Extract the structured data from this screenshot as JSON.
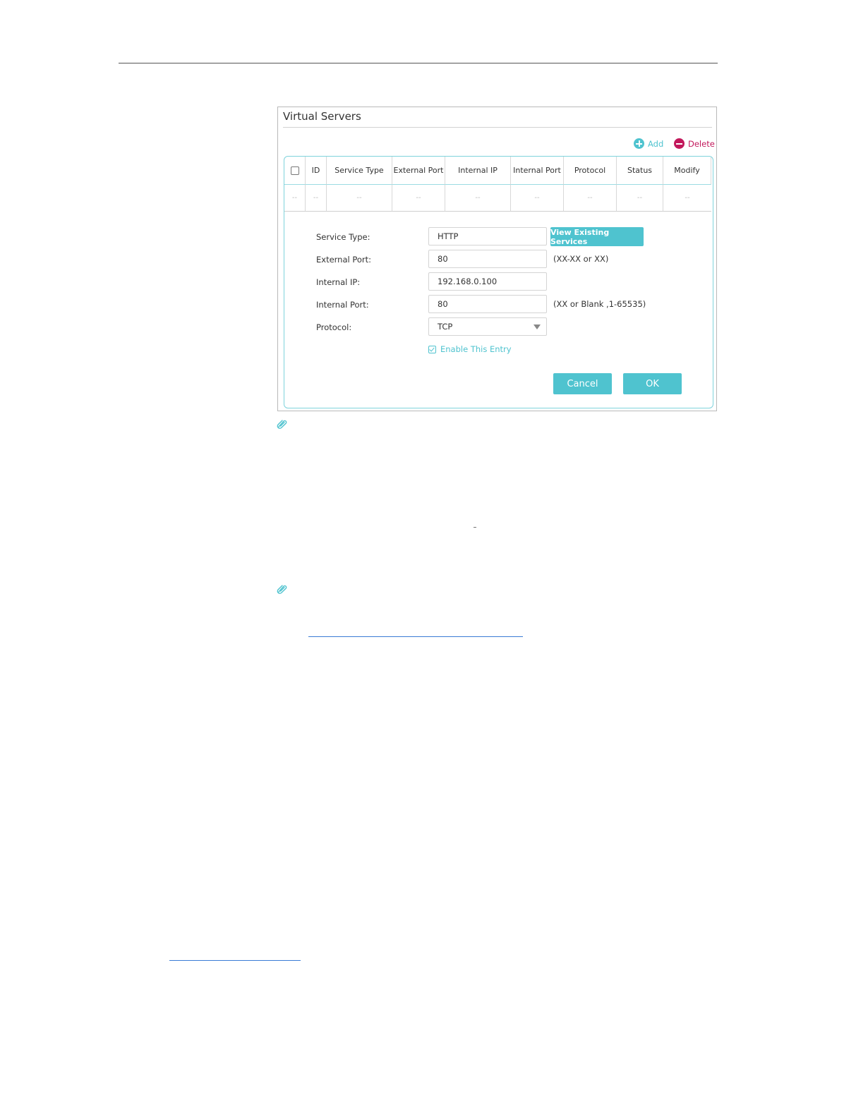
{
  "panel": {
    "title": "Virtual Servers",
    "add_label": "Add",
    "delete_label": "Delete"
  },
  "table": {
    "columns": [
      "ID",
      "Service Type",
      "External Port",
      "Internal IP",
      "Internal Port",
      "Protocol",
      "Status",
      "Modify"
    ],
    "empty_row": [
      "--",
      "--",
      "--",
      "--",
      "--",
      "--",
      "--",
      "--",
      "--"
    ]
  },
  "form": {
    "service_type_label": "Service Type:",
    "service_type_value": "HTTP",
    "view_services_label": "View Existing Services",
    "external_port_label": "External Port:",
    "external_port_value": "80",
    "external_port_hint": "(XX-XX or XX)",
    "internal_ip_label": "Internal IP:",
    "internal_ip_value": "192.168.0.100",
    "internal_port_label": "Internal Port:",
    "internal_port_value": "80",
    "internal_port_hint": "(XX or Blank ,1-65535)",
    "protocol_label": "Protocol:",
    "protocol_value": "TCP",
    "enable_label": "Enable This Entry",
    "enable_checked": true,
    "cancel_label": "Cancel",
    "ok_label": "OK"
  },
  "colors": {
    "accent": "#4fc3cf",
    "delete": "#c2185b"
  },
  "icons": [
    "plus-circle-icon",
    "minus-circle-icon",
    "paperclip-icon",
    "chevron-down-icon"
  ]
}
